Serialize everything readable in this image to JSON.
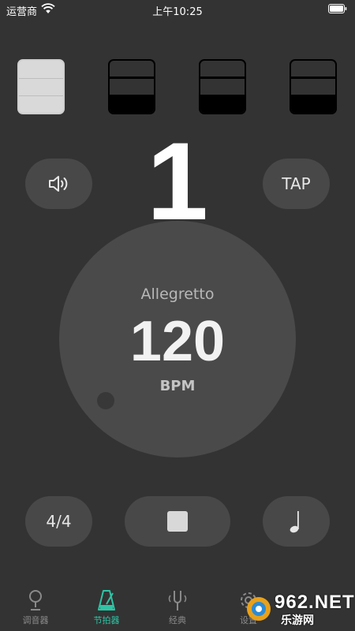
{
  "status_bar": {
    "carrier": "运营商",
    "time": "上午10:25"
  },
  "beats": [
    {
      "state": "active"
    },
    {
      "state": "inactive"
    },
    {
      "state": "inactive"
    },
    {
      "state": "inactive"
    }
  ],
  "current_beat": "1",
  "controls": {
    "sound_icon": "speaker-icon",
    "tap_label": "TAP",
    "time_signature": "4/4",
    "stop_icon": "stop-icon",
    "note_icon": "quarter-note-icon"
  },
  "dial": {
    "tempo_name": "Allegretto",
    "bpm": "120",
    "unit": "BPM"
  },
  "tabs": [
    {
      "label": "调音器",
      "icon": "tuner-icon",
      "active": false
    },
    {
      "label": "节拍器",
      "icon": "metronome-icon",
      "active": true
    },
    {
      "label": "经典",
      "icon": "tuning-fork-icon",
      "active": false
    },
    {
      "label": "设置",
      "icon": "gear-icon",
      "active": false
    }
  ],
  "watermark": {
    "brand": "962.NET",
    "sub": "乐游网"
  },
  "colors": {
    "background": "#333333",
    "button": "#484848",
    "accent": "#2ec5a5"
  }
}
